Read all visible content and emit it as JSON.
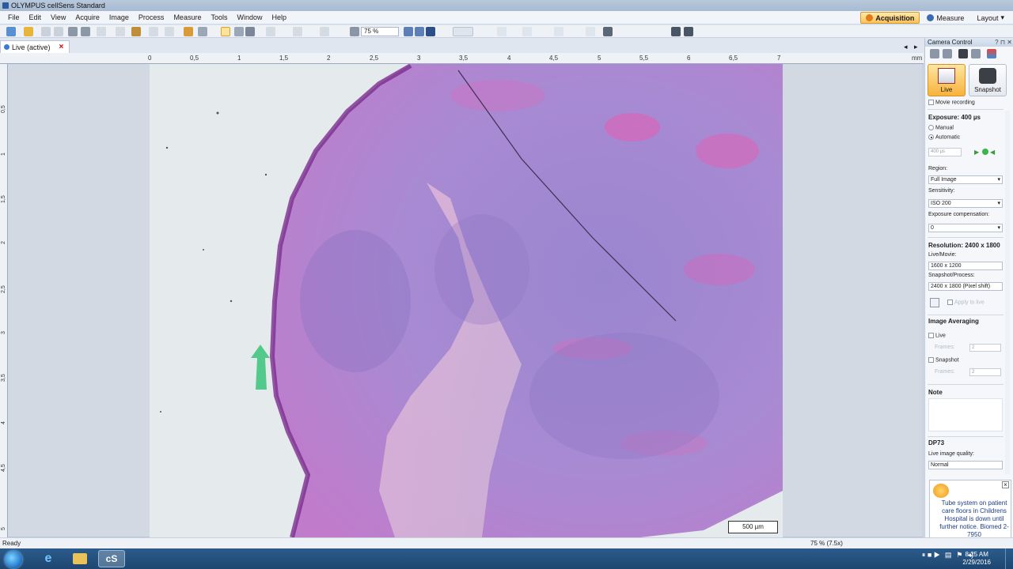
{
  "window": {
    "title": "OLYMPUS cellSens Standard"
  },
  "menu": {
    "items": [
      "File",
      "Edit",
      "View",
      "Acquire",
      "Image",
      "Process",
      "Measure",
      "Tools",
      "Window",
      "Help"
    ]
  },
  "layouts": {
    "acquisition": "Acquisition",
    "measure": "Measure",
    "layout": "Layout"
  },
  "toolbar": {
    "zoom_value": "75 %"
  },
  "document": {
    "tab_label": "Live (active)",
    "scalebar": "500 µm"
  },
  "rulers": {
    "h_ticks": [
      "0",
      "0,5",
      "1",
      "1,5",
      "2",
      "2,5",
      "3",
      "3,5",
      "4",
      "4,5",
      "5",
      "5,5",
      "6",
      "6,5",
      "7"
    ],
    "h_unit": "mm",
    "v_ticks": [
      "0,5",
      "1",
      "1,5",
      "2",
      "2,5",
      "3",
      "3,5",
      "4",
      "4,5",
      "5"
    ]
  },
  "camera_control": {
    "header": "Camera Control",
    "live_label": "Live",
    "snapshot_label": "Snapshot",
    "movie_recording": "Movie recording",
    "exposure_title": "Exposure: 400 µs",
    "manual": "Manual",
    "automatic": "Automatic",
    "exposure_input": "400 µs",
    "region_label": "Region:",
    "region_value": "Full Image",
    "sensitivity_label": "Sensitivity:",
    "sensitivity_value": "ISO 200",
    "exp_comp_label": "Exposure compensation:",
    "exp_comp_value": "0",
    "resolution_title": "Resolution: 2400 x 1800",
    "live_movie_label": "Live/Movie:",
    "live_movie_value": "1600 x 1200",
    "snapshot_process_label": "Snapshot/Process:",
    "snapshot_process_value": "2400 x 1800 (Pixel shift)",
    "apply_to_roi": "Apply to live",
    "image_averaging": "Image Averaging",
    "avg_live": "Live",
    "frames_label": "Frames:",
    "frames_live": "2",
    "avg_snapshot": "Snapshot",
    "frames_snapshot": "2",
    "note": "Note",
    "camera_model": "DP73",
    "live_quality_label": "Live image quality:",
    "live_quality_value": "Normal"
  },
  "notification": {
    "message": "Tube system on patient care floors in Childrens Hospital is down until further notice. Biomed 2-7950"
  },
  "status": {
    "text": "Ready",
    "zoom": "75 % (7.5x)"
  },
  "taskbar": {
    "time": "8:25 AM",
    "date": "2/29/2016",
    "app_label": "cS"
  },
  "colors": {
    "accent": "#f7b23c",
    "stain_pink": "#d86bbf",
    "stain_purple": "#8a78c6"
  }
}
